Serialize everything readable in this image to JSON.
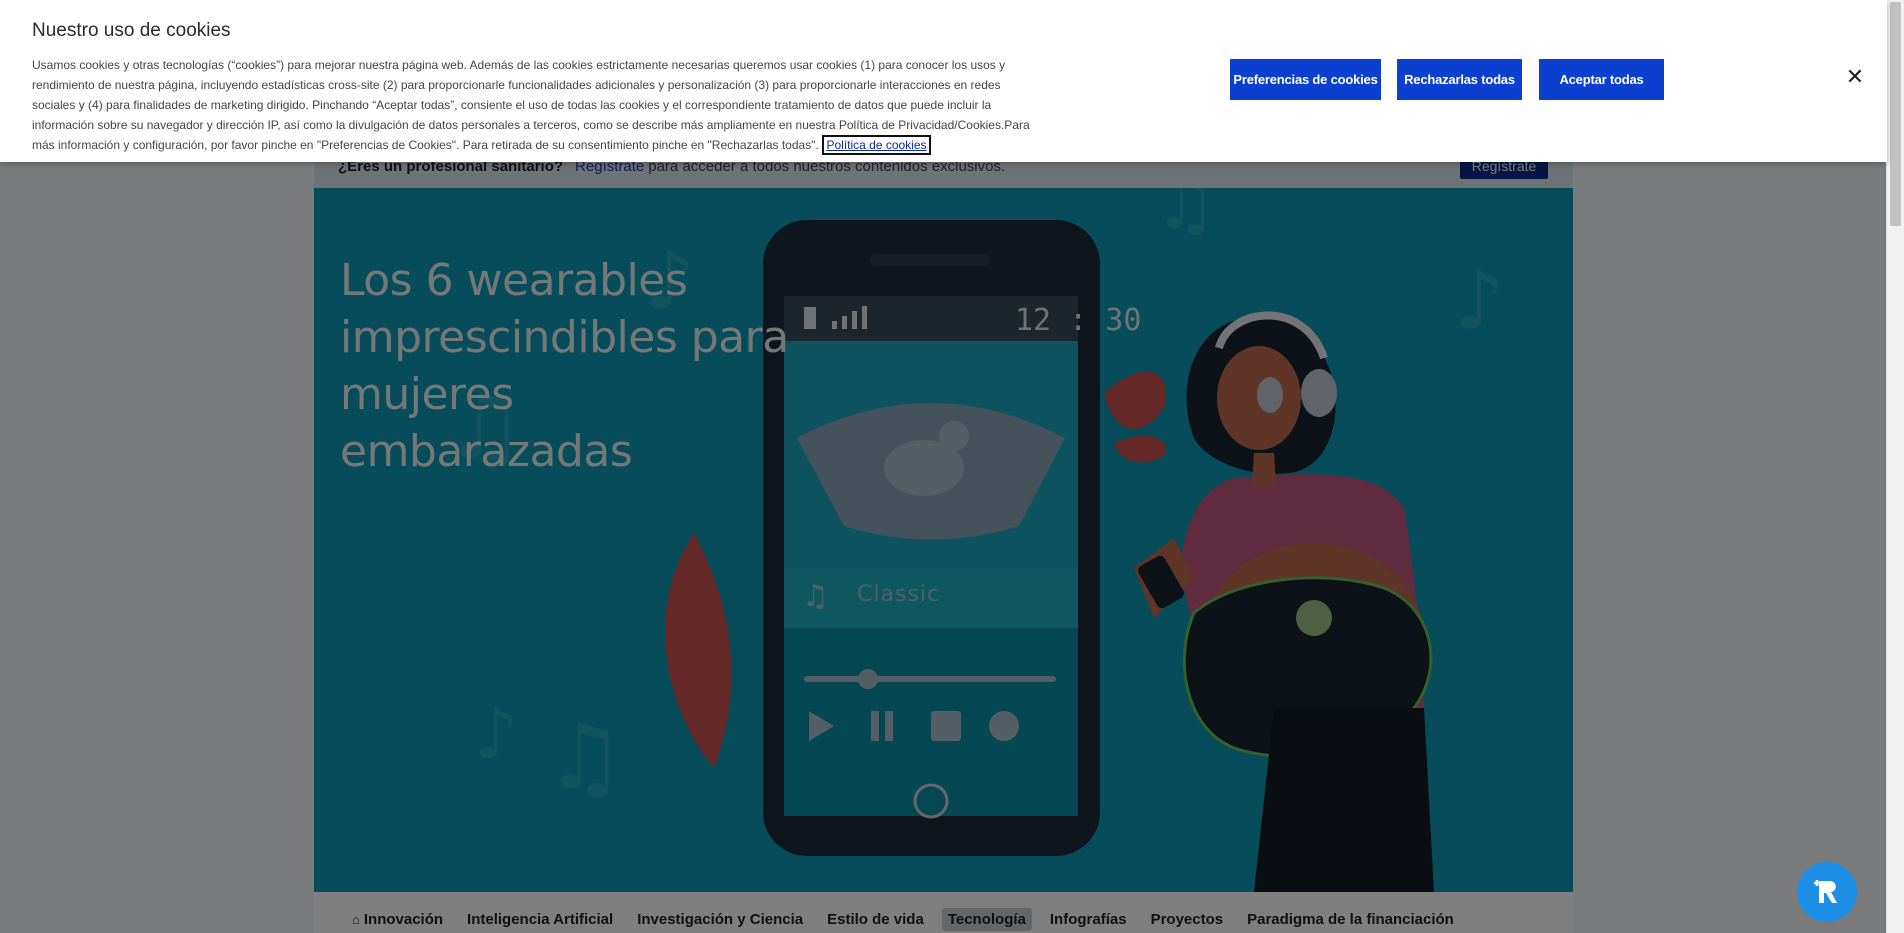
{
  "cookie_banner": {
    "title": "Nuestro uso de cookies",
    "body": "Usamos cookies y otras tecnologías (“cookies”) para mejorar nuestra página web. Además de las cookies estrictamente necesarias queremos usar cookies (1) para conocer los usos y rendimiento de nuestra página, incluyendo estadísticas cross-site (2) para proporcionarle funcionalidades adicionales y personalización (3) para proporcionarle interacciones en redes sociales y (4) para finalidades de marketing dirigido. Pinchando “Aceptar todas”, consiente el uso de todas las cookies y el correspondiente tratamiento de datos que puede incluir la información sobre su navegador y dirección IP, así como la divulgación de datos personales a terceros, como se describe más ampliamente en nuestra Política de Privacidad/Cookies.Para más información y configuración, por favor pinche en \"Preferencias de Cookies\". Para retirada de su consentimiento pinche en \"Rechazarlas todas\".",
    "policy_link": "Política de cookies",
    "btn_preferences": "Preferencias de cookies",
    "btn_reject": "Rechazarlas todas",
    "btn_accept": "Aceptar todas",
    "close_icon": "close-icon"
  },
  "hp_banner": {
    "question": "¿Eres un profesional sanitario?",
    "link": "Regístrate",
    "rest": "para acceder a todos nuestros contenidos exclusivos.",
    "button": "Regístrate"
  },
  "hero": {
    "title": "Los 6 wearables imprescindibles para mujeres embarazadas",
    "phone_time": "12 : 30",
    "track": "Classic"
  },
  "nav": {
    "items": [
      {
        "label": "Innovación",
        "icon": "home-icon"
      },
      {
        "label": "Inteligencia Artificial"
      },
      {
        "label": "Investigación y Ciencia"
      },
      {
        "label": "Estilo de vida"
      },
      {
        "label": "Tecnología",
        "active": true
      },
      {
        "label": "Infografías"
      },
      {
        "label": "Proyectos"
      },
      {
        "label": "Paradigma de la financiación"
      }
    ]
  },
  "colors": {
    "accent": "#0a3fd0",
    "hero_bg": "#0e99b4",
    "chat": "#1e8fe6"
  }
}
